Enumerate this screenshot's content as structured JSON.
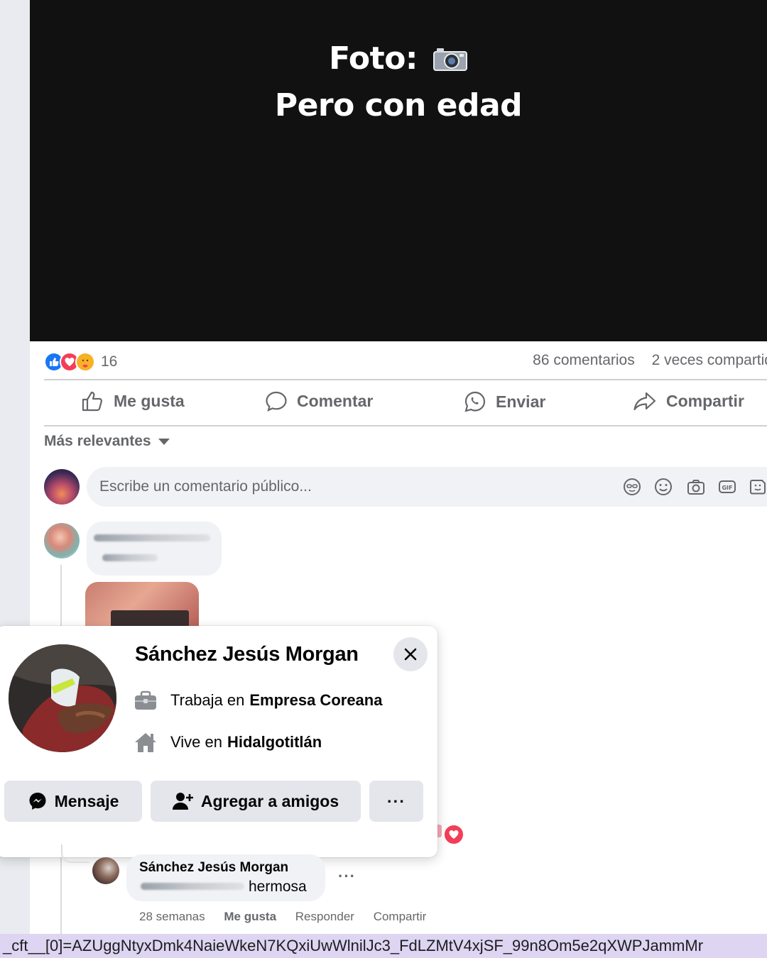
{
  "post": {
    "caption_line1": "Foto:",
    "caption_line2": "Pero con edad",
    "caption_icon": "camera-icon"
  },
  "stats": {
    "reaction_icons": [
      "like-reaction-icon",
      "love-reaction-icon",
      "care-reaction-icon"
    ],
    "reaction_count": "16",
    "comments": "86 comentarios",
    "shares": "2 veces compartid"
  },
  "actions": {
    "like": "Me gusta",
    "comment": "Comentar",
    "send": "Enviar",
    "share": "Compartir"
  },
  "sort": {
    "label": "Más relevantes"
  },
  "comment_input": {
    "placeholder": "Escribe un comentario público..."
  },
  "profile_card": {
    "name": "Sánchez Jesús Morgan",
    "work_prefix": "Trabaja en",
    "work_place": "Empresa Coreana",
    "lives_prefix": "Vive en",
    "lives_place": "Hidalgotitlán",
    "message_button": "Mensaje",
    "add_friend_button": "Agregar a amigos",
    "more_button": "···"
  },
  "reply": {
    "author": "Sánchez Jesús Morgan",
    "text": "hermosa",
    "more": "···",
    "time": "28 semanas",
    "like": "Me gusta",
    "reply": "Responder",
    "share": "Compartir"
  },
  "url_fragment": "_cft__[0]=AZUggNtyxDmk4NaieWkeN7KQxiUwWlnilJc3_FdLZMtV4xjSF_99n8Om5e2qXWPJammMr",
  "colors": {
    "accent_blue": "#1877f2",
    "love_red": "#f33e58",
    "secondary_text": "#65676b",
    "bubble_gray": "#f0f2f5",
    "url_bar": "#ddd5f1"
  }
}
